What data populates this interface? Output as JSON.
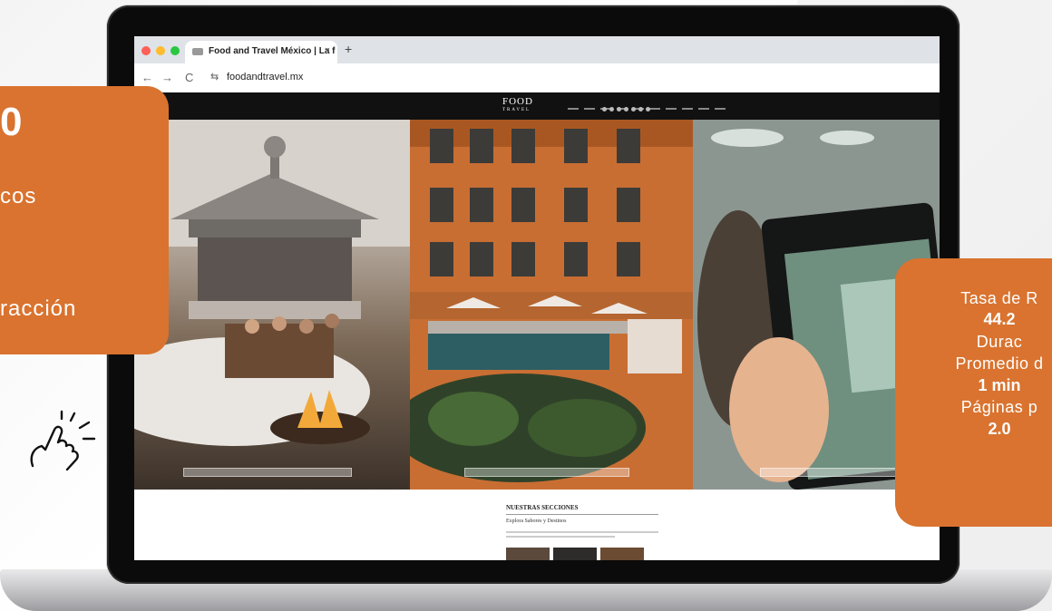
{
  "browser": {
    "tab_title": "Food and Travel México | La f",
    "tab_close": "×",
    "new_tab": "+",
    "url": "foodandtravel.mx",
    "back": "←",
    "forward": "→",
    "reload": "C",
    "site_settings": "⇆",
    "dots": [
      "#ff5f57",
      "#febc2e",
      "#28c840"
    ]
  },
  "site": {
    "logo": "FOOD",
    "logo_sub": "TRAVEL",
    "sections_title": "NUESTRAS SECCIONES",
    "sections_subtitle": "Explora Sabores y Destinos"
  },
  "overlay_left": {
    "number": "0",
    "line1": "cos",
    "line2": "racción"
  },
  "overlay_right": {
    "label1": "Tasa de R",
    "value1": "44.2",
    "label2": "Durac",
    "label3": "Promedio d",
    "value2": "1 min",
    "label4": "Páginas p",
    "value3": "2.0"
  },
  "colors": {
    "accent": "#d9732f",
    "header": "#111111"
  },
  "icons": [
    "back-icon",
    "forward-icon",
    "reload-icon",
    "site-settings-icon",
    "favicon-icon",
    "close-icon",
    "tap-hand-icon"
  ]
}
